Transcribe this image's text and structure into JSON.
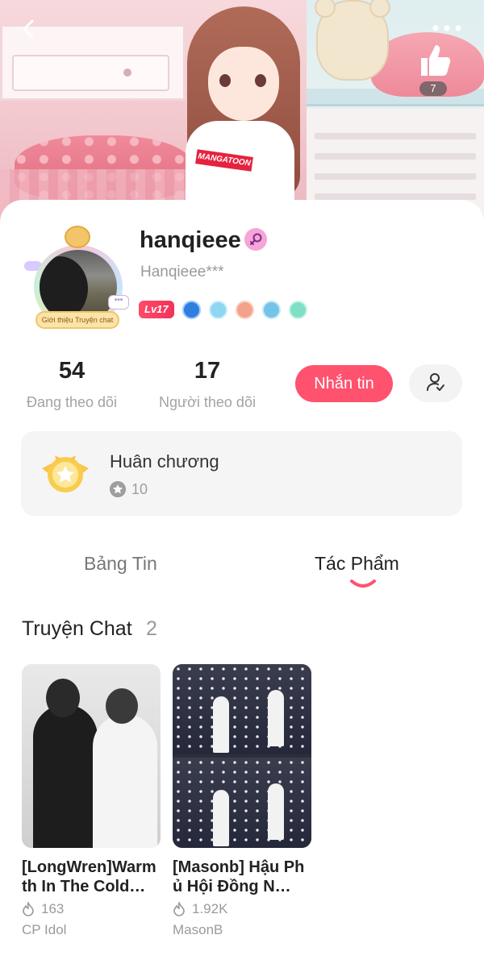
{
  "header": {
    "shirt_logo": "MANGATOON",
    "like_count": "7"
  },
  "profile": {
    "username": "hanqieee",
    "handle": "Hanqieee***",
    "avatar_banner": "Giới thiệu Truyện chat",
    "level": "Lv17"
  },
  "stats": {
    "following_count": "54",
    "following_label": "Đang theo dõi",
    "followers_count": "17",
    "followers_label": "Người theo dõi"
  },
  "actions": {
    "message_label": "Nhắn tin"
  },
  "medals": {
    "title": "Huân chương",
    "count": "10"
  },
  "tabs": [
    {
      "label": "Bảng Tin",
      "active": false
    },
    {
      "label": "Tác Phẩm",
      "active": true
    }
  ],
  "section": {
    "title": "Truyện Chat",
    "count": "2"
  },
  "stories": [
    {
      "title": "[LongWren]Warmth In The Cold…",
      "views": "163",
      "author": "CP Idol"
    },
    {
      "title": "[Masonb] Hậu Phủ Hội Đồng N…",
      "views": "1.92K",
      "author": "MasonB"
    }
  ],
  "colors": {
    "accent": "#ff526e",
    "muted_text": "#9a9a9a",
    "card_bg": "#f5f5f5"
  }
}
